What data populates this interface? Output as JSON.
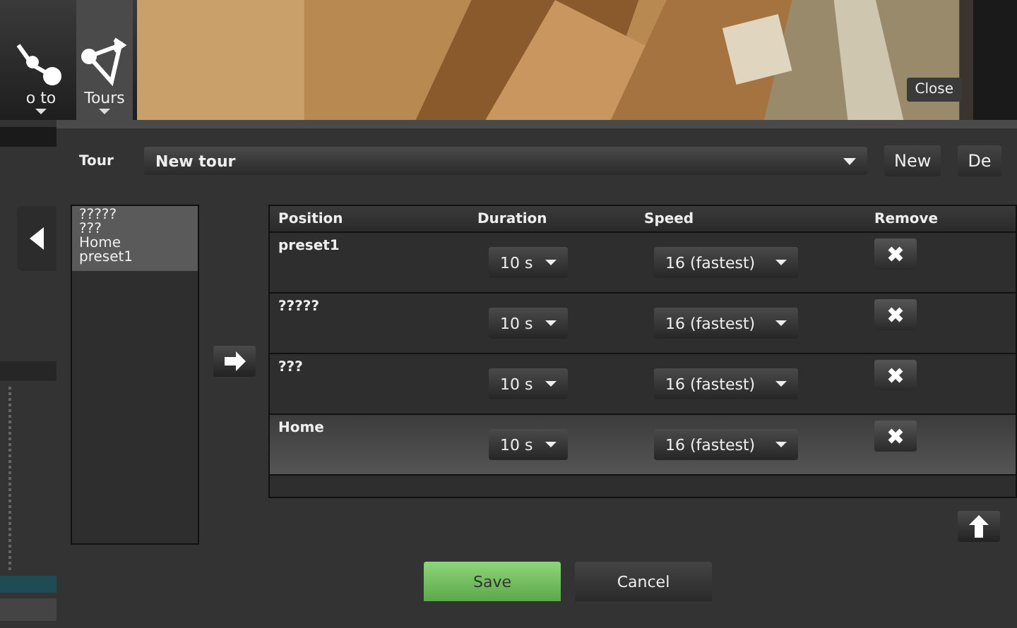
{
  "toolbar": {
    "buttons": [
      {
        "kind": "goto",
        "label": "o to",
        "selected": false
      },
      {
        "kind": "tours",
        "label": "Tours",
        "selected": true
      }
    ]
  },
  "video": {
    "kind": "picture",
    "close_label": "Close"
  },
  "dialog": {
    "tour_label": "Tour",
    "tour_value": "New tour",
    "buttons": [
      "New",
      "De"
    ],
    "positions": [
      {
        "name": "?????",
        "selected": true
      },
      {
        "name": "???",
        "selected": true
      },
      {
        "name": "Home",
        "selected": true
      },
      {
        "name": "preset1",
        "selected": true
      }
    ],
    "table": {
      "columns": [
        "Position",
        "Duration",
        "Speed",
        "Remove"
      ],
      "rows": [
        {
          "position": "preset1",
          "duration": "10 s",
          "speed": "16 (fastest)",
          "selected": false
        },
        {
          "position": "?????",
          "duration": "10 s",
          "speed": "16 (fastest)",
          "selected": false
        },
        {
          "position": "???",
          "duration": "10 s",
          "speed": "16 (fastest)",
          "selected": false
        },
        {
          "position": "Home",
          "duration": "10 s",
          "speed": "16 (fastest)",
          "selected": true
        }
      ]
    },
    "footer": [
      "Save",
      "Cancel"
    ]
  }
}
